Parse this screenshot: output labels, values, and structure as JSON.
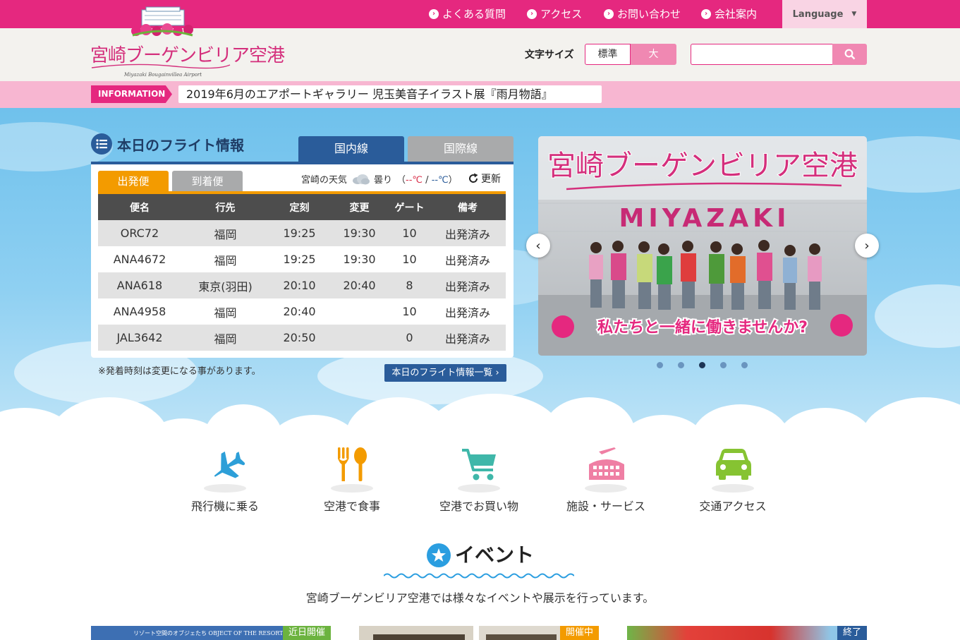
{
  "topnav": {
    "faq": "よくある質問",
    "access": "アクセス",
    "contact": "お問い合わせ",
    "company": "会社案内",
    "language": "Language"
  },
  "header": {
    "logo_text": "宮崎ブーゲンビリア空港",
    "logo_sub": "Miyazaki Bougainvillea Airport",
    "fontsize_label": "文字サイズ",
    "fontsize_standard": "標準",
    "fontsize_large": "大",
    "search_placeholder": ""
  },
  "info": {
    "tag": "INFORMATION",
    "news": "2019年6月のエアポートギャラリー 児玉美音子イラスト展『雨月物語』"
  },
  "flight": {
    "title": "本日のフライト情報",
    "tab_domestic": "国内線",
    "tab_international": "国際線",
    "sub_departures": "出発便",
    "sub_arrivals": "到着便",
    "weather_label": "宮崎の天気",
    "weather_condition": "曇り",
    "temp_open": "（",
    "temp_high": "--℃",
    "temp_sep": " / ",
    "temp_low": "--℃",
    "temp_close": "）",
    "refresh": "更新",
    "columns": [
      "便名",
      "行先",
      "定刻",
      "変更",
      "ゲート",
      "備考"
    ],
    "rows": [
      [
        "ORC72",
        "福岡",
        "19:25",
        "19:30",
        "10",
        "出発済み"
      ],
      [
        "ANA4672",
        "福岡",
        "19:25",
        "19:30",
        "10",
        "出発済み"
      ],
      [
        "ANA618",
        "東京(羽田)",
        "20:10",
        "20:40",
        "8",
        "出発済み"
      ],
      [
        "ANA4958",
        "福岡",
        "20:40",
        "",
        "10",
        "出発済み"
      ],
      [
        "JAL3642",
        "福岡",
        "20:50",
        "",
        "0",
        "出発済み"
      ]
    ],
    "note": "※発着時刻は変更になる事があります。",
    "list_button": "本日のフライト情報一覧"
  },
  "slide": {
    "title": "宮崎ブーゲンビリア空港",
    "sign": "MIYAZAKI",
    "caption": "私たちと一緒に働きませんか?",
    "dots": 5,
    "active_dot": 3
  },
  "categories": [
    "飛行機に乗る",
    "空港で食事",
    "空港でお買い物",
    "施設・サービス",
    "交通アクセス"
  ],
  "event": {
    "title": "イベント",
    "desc": "宮崎ブーゲンビリア空港では様々なイベントや展示を行っています。",
    "card1_caption": "リゾート空間のオブジェたち OBJECT OF THE RESORT",
    "badges": [
      "近日開催",
      "開催中",
      "終了"
    ]
  },
  "colors": {
    "brand_pink": "#e5287f",
    "navy": "#2a5c9a",
    "orange": "#f39b00"
  }
}
